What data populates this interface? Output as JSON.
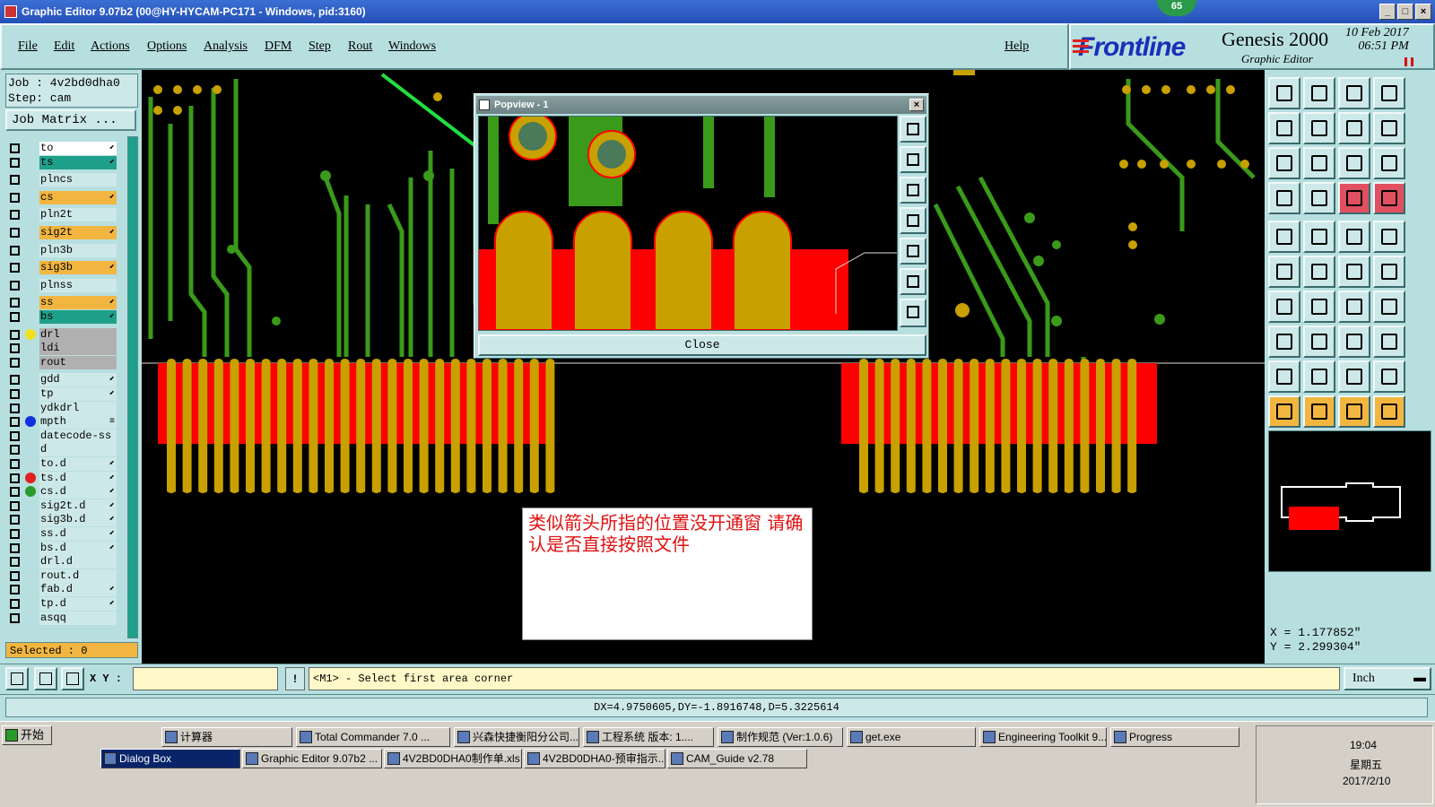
{
  "window": {
    "title": "Graphic Editor 9.07b2 (00@HY-HYCAM-PC171 - Windows, pid:3160)",
    "badge": "65"
  },
  "menu": [
    "File",
    "Edit",
    "Actions",
    "Options",
    "Analysis",
    "DFM",
    "Step",
    "Rout",
    "Windows"
  ],
  "help_label": "Help",
  "brand": {
    "logo": "Frontline",
    "product": "Genesis 2000",
    "subtitle": "Graphic Editor",
    "date": "10 Feb 2017",
    "time": "06:51 PM"
  },
  "job": {
    "job_line": "Job : 4v2bd0dha0",
    "step_line": "Step: cam",
    "matrix_button": "Job Matrix ..."
  },
  "layers": [
    {
      "name": "to",
      "style": "white",
      "arrow": "⬋"
    },
    {
      "name": "ts",
      "style": "teal",
      "arrow": "⬋"
    },
    {
      "name": "plncs",
      "style": "plain",
      "arrow": ""
    },
    {
      "name": "cs",
      "style": "orange",
      "arrow": "⬋"
    },
    {
      "name": "pln2t",
      "style": "plain",
      "arrow": ""
    },
    {
      "name": "sig2t",
      "style": "orange",
      "arrow": "⬋"
    },
    {
      "name": "pln3b",
      "style": "plain",
      "arrow": ""
    },
    {
      "name": "sig3b",
      "style": "orange",
      "arrow": "⬋"
    },
    {
      "name": "plnss",
      "style": "plain",
      "arrow": ""
    },
    {
      "name": "ss",
      "style": "orange",
      "arrow": "⬋"
    },
    {
      "name": "bs",
      "style": "teal",
      "arrow": "⬋"
    },
    {
      "name": "drl",
      "style": "gray",
      "arrow": "",
      "dot": "#f0e020"
    },
    {
      "name": "ldi",
      "style": "gray",
      "arrow": ""
    },
    {
      "name": "rout",
      "style": "gray",
      "arrow": ""
    },
    {
      "name": "gdd",
      "style": "plain",
      "arrow": "⬋"
    },
    {
      "name": "tp",
      "style": "plain",
      "arrow": "⬋"
    },
    {
      "name": "ydkdrl",
      "style": "plain",
      "arrow": ""
    },
    {
      "name": "mpth",
      "style": "plain",
      "arrow": "≡",
      "dot": "#1030e0"
    },
    {
      "name": "datecode-ss",
      "style": "plain",
      "arrow": ""
    },
    {
      "name": "d",
      "style": "plain",
      "arrow": ""
    },
    {
      "name": "to.d",
      "style": "plain",
      "arrow": "⬋"
    },
    {
      "name": "ts.d",
      "style": "plain",
      "arrow": "⬋",
      "dot": "#e02020"
    },
    {
      "name": "cs.d",
      "style": "plain",
      "arrow": "⬋",
      "dot": "#2a9a2a"
    },
    {
      "name": "sig2t.d",
      "style": "plain",
      "arrow": "⬋"
    },
    {
      "name": "sig3b.d",
      "style": "plain",
      "arrow": "⬋"
    },
    {
      "name": "ss.d",
      "style": "plain",
      "arrow": "⬋"
    },
    {
      "name": "bs.d",
      "style": "plain",
      "arrow": "⬋"
    },
    {
      "name": "drl.d",
      "style": "plain",
      "arrow": ""
    },
    {
      "name": "rout.d",
      "style": "plain",
      "arrow": ""
    },
    {
      "name": "fab.d",
      "style": "plain",
      "arrow": "⬋"
    },
    {
      "name": "tp.d",
      "style": "plain",
      "arrow": "⬋"
    },
    {
      "name": "asqq",
      "style": "plain",
      "arrow": ""
    }
  ],
  "selected_label": "Selected : 0",
  "popview": {
    "title": "Popview - 1",
    "close_label": "Close"
  },
  "note_text": "类似箭头所指的位置没开通窗  请确认是否直接按照文件",
  "coords": {
    "x": "X = 1.177852\"",
    "y": "Y = 2.299304\""
  },
  "bottom": {
    "xy_label": "X Y :",
    "xy_value": "",
    "prompt": "<M1> - Select first area corner",
    "units": "Inch"
  },
  "status": "DX=4.9750605,DY=-1.8916748,D=5.3225614",
  "taskbar": {
    "start": "开始",
    "row1": [
      "计算器",
      "Total Commander 7.0 ...",
      "兴森快捷衡阳分公司...",
      "工程系统  版本: 1....",
      "制作规范 (Ver:1.0.6)",
      "get.exe",
      "Engineering Toolkit 9....",
      "Progress"
    ],
    "row2": [
      "Dialog Box",
      "Graphic Editor 9.07b2 ...",
      "4V2BD0DHA0制作单.xls ...",
      "4V2BD0DHA0-预审指示....",
      "CAM_Guide v2.78"
    ],
    "clock": "19:04",
    "weekday": "星期五",
    "date": "2017/2/10"
  },
  "colors": {
    "copper": "#c8a000",
    "mask": "#ff0000",
    "trace": "#3a9a1a",
    "panel": "#b8dfe0"
  }
}
